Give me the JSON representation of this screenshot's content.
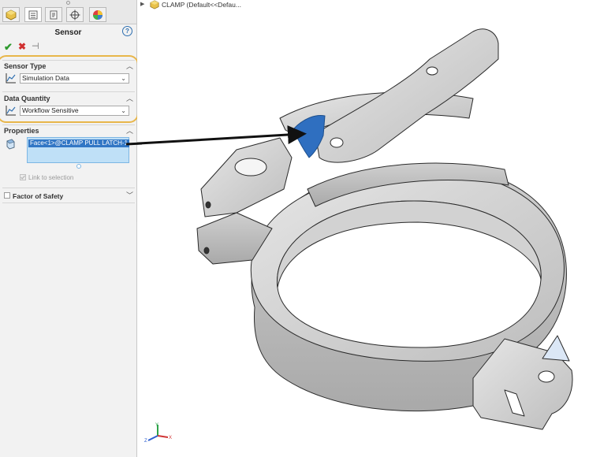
{
  "panel": {
    "title": "Sensor",
    "help_label": "?",
    "ok_label": "✔",
    "cancel_label": "✖",
    "pin_label": "⊣",
    "tabs": [
      "part-icon",
      "property-manager-icon",
      "configuration-icon",
      "dimxpert-icon",
      "appearance-icon"
    ]
  },
  "sensor_type": {
    "header": "Sensor Type",
    "value": "Simulation Data",
    "icon": "sensor-graph-icon"
  },
  "data_quantity": {
    "header": "Data Quantity",
    "value": "Workflow Sensitive",
    "icon": "sensor-graph-icon"
  },
  "properties": {
    "header": "Properties",
    "selection": "Face<1>@CLAMP PULL LATCH-1",
    "link_label": "Link to selection",
    "link_checked": true
  },
  "factor_of_safety": {
    "label": "Factor of Safety",
    "checked": false
  },
  "tree": {
    "label": "CLAMP  (Default<<Defau..."
  },
  "colors": {
    "accent": "#3277c5",
    "highlight_frame": "#e8b64a",
    "selected_face": "#2f6fc0",
    "model_gray": "#d8d8d8"
  }
}
